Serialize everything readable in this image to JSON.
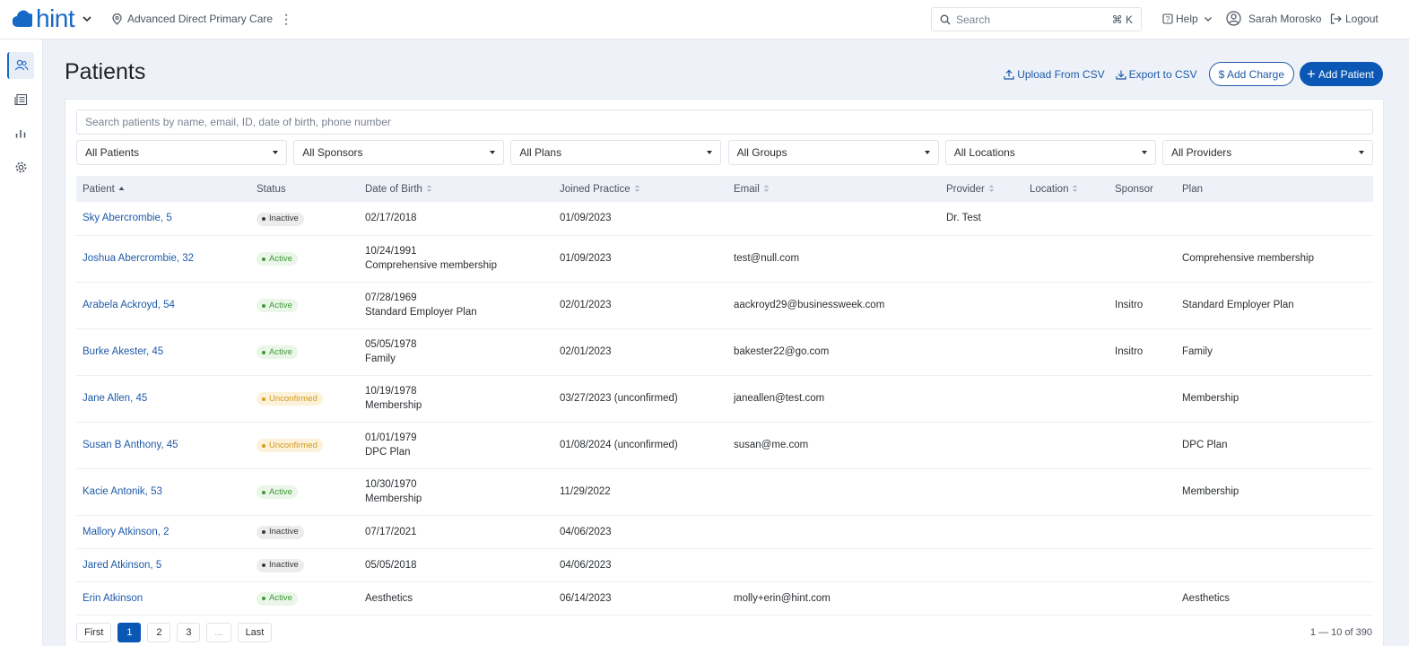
{
  "app": {
    "brand": "hint",
    "practice": "Advanced Direct Primary Care"
  },
  "topbar": {
    "search_placeholder": "Search",
    "search_shortcut": "⌘ K",
    "help": "Help",
    "user": "Sarah Morosko",
    "logout": "Logout"
  },
  "sidebar": {
    "items": [
      "patients-icon",
      "billing-icon",
      "reports-icon",
      "settings-icon"
    ],
    "active": "patients-icon"
  },
  "page": {
    "title": "Patients",
    "upload": "Upload From CSV",
    "export": "Export to CSV",
    "add_charge": "$ Add Charge",
    "add_patient": "Add Patient"
  },
  "search": {
    "placeholder": "Search patients by name, email, ID, date of birth, phone number"
  },
  "filters": [
    "All Patients",
    "All Sponsors",
    "All Plans",
    "All Groups",
    "All Locations",
    "All Providers"
  ],
  "table": {
    "columns": [
      "Patient",
      "Status",
      "Date of Birth",
      "Joined Practice",
      "Email",
      "Provider",
      "Location",
      "Sponsor",
      "Plan"
    ],
    "rows": [
      {
        "patient": "Sky Abercrombie, 5",
        "status": "Inactive",
        "dob": "02/17/2018",
        "dob_sub": "",
        "joined": "01/09/2023",
        "email": "",
        "provider": "Dr. Test",
        "location": "",
        "sponsor": "",
        "plan": ""
      },
      {
        "patient": "Joshua Abercrombie, 32",
        "status": "Active",
        "dob": "10/24/1991",
        "dob_sub": "Comprehensive membership",
        "joined": "01/09/2023",
        "email": "test@null.com",
        "provider": "",
        "location": "",
        "sponsor": "",
        "plan": "Comprehensive membership"
      },
      {
        "patient": "Arabela Ackroyd, 54",
        "status": "Active",
        "dob": "07/28/1969",
        "dob_sub": "Standard Employer Plan",
        "joined": "02/01/2023",
        "email": "aackroyd29@businessweek.com",
        "provider": "",
        "location": "",
        "sponsor": "Insitro",
        "plan": "Standard Employer Plan"
      },
      {
        "patient": "Burke Akester, 45",
        "status": "Active",
        "dob": "05/05/1978",
        "dob_sub": "Family",
        "joined": "02/01/2023",
        "email": "bakester22@go.com",
        "provider": "",
        "location": "",
        "sponsor": "Insitro",
        "plan": "Family"
      },
      {
        "patient": "Jane Allen, 45",
        "status": "Unconfirmed",
        "dob": "10/19/1978",
        "dob_sub": "Membership",
        "joined": "03/27/2023 (unconfirmed)",
        "email": "janeallen@test.com",
        "provider": "",
        "location": "",
        "sponsor": "",
        "plan": "Membership"
      },
      {
        "patient": "Susan B Anthony, 45",
        "status": "Unconfirmed",
        "dob": "01/01/1979",
        "dob_sub": "DPC Plan",
        "joined": "01/08/2024 (unconfirmed)",
        "email": "susan@me.com",
        "provider": "",
        "location": "",
        "sponsor": "",
        "plan": "DPC Plan"
      },
      {
        "patient": "Kacie Antonik, 53",
        "status": "Active",
        "dob": "10/30/1970",
        "dob_sub": "Membership",
        "joined": "11/29/2022",
        "email": "",
        "provider": "",
        "location": "",
        "sponsor": "",
        "plan": "Membership"
      },
      {
        "patient": "Mallory Atkinson, 2",
        "status": "Inactive",
        "dob": "07/17/2021",
        "dob_sub": "",
        "joined": "04/06/2023",
        "email": "",
        "provider": "",
        "location": "",
        "sponsor": "",
        "plan": ""
      },
      {
        "patient": "Jared Atkinson, 5",
        "status": "Inactive",
        "dob": "05/05/2018",
        "dob_sub": "",
        "joined": "04/06/2023",
        "email": "",
        "provider": "",
        "location": "",
        "sponsor": "",
        "plan": ""
      },
      {
        "patient": "Erin Atkinson",
        "status": "Active",
        "dob": "Aesthetics",
        "dob_sub": "",
        "joined": "06/14/2023",
        "email": "molly+erin@hint.com",
        "provider": "",
        "location": "",
        "sponsor": "",
        "plan": "Aesthetics"
      }
    ]
  },
  "pagination": {
    "first": "First",
    "pages": [
      "1",
      "2",
      "3"
    ],
    "current": "1",
    "ellipsis": "...",
    "last": "Last",
    "count": "1 — 10 of 390"
  },
  "colors": {
    "brand": "#1769c7",
    "primary": "#0b57b5",
    "link": "#1e5aa8",
    "active": "#3d9a34",
    "unconfirmed": "#d49a22",
    "inactive": "#3a3a3a"
  }
}
